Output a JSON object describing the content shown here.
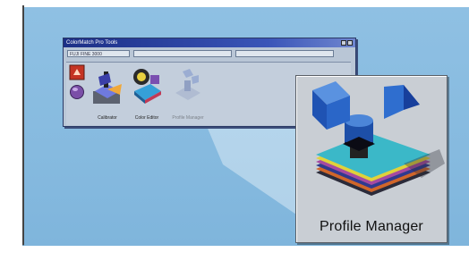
{
  "window": {
    "title": "ColorMatch Pro Tools",
    "combo_value": "FUJI FINE 3000"
  },
  "tiles": [
    {
      "label": "Calibrator"
    },
    {
      "label": "Color Editor"
    },
    {
      "label": "Profile Manager"
    }
  ],
  "zoom": {
    "label": "Profile Manager"
  }
}
